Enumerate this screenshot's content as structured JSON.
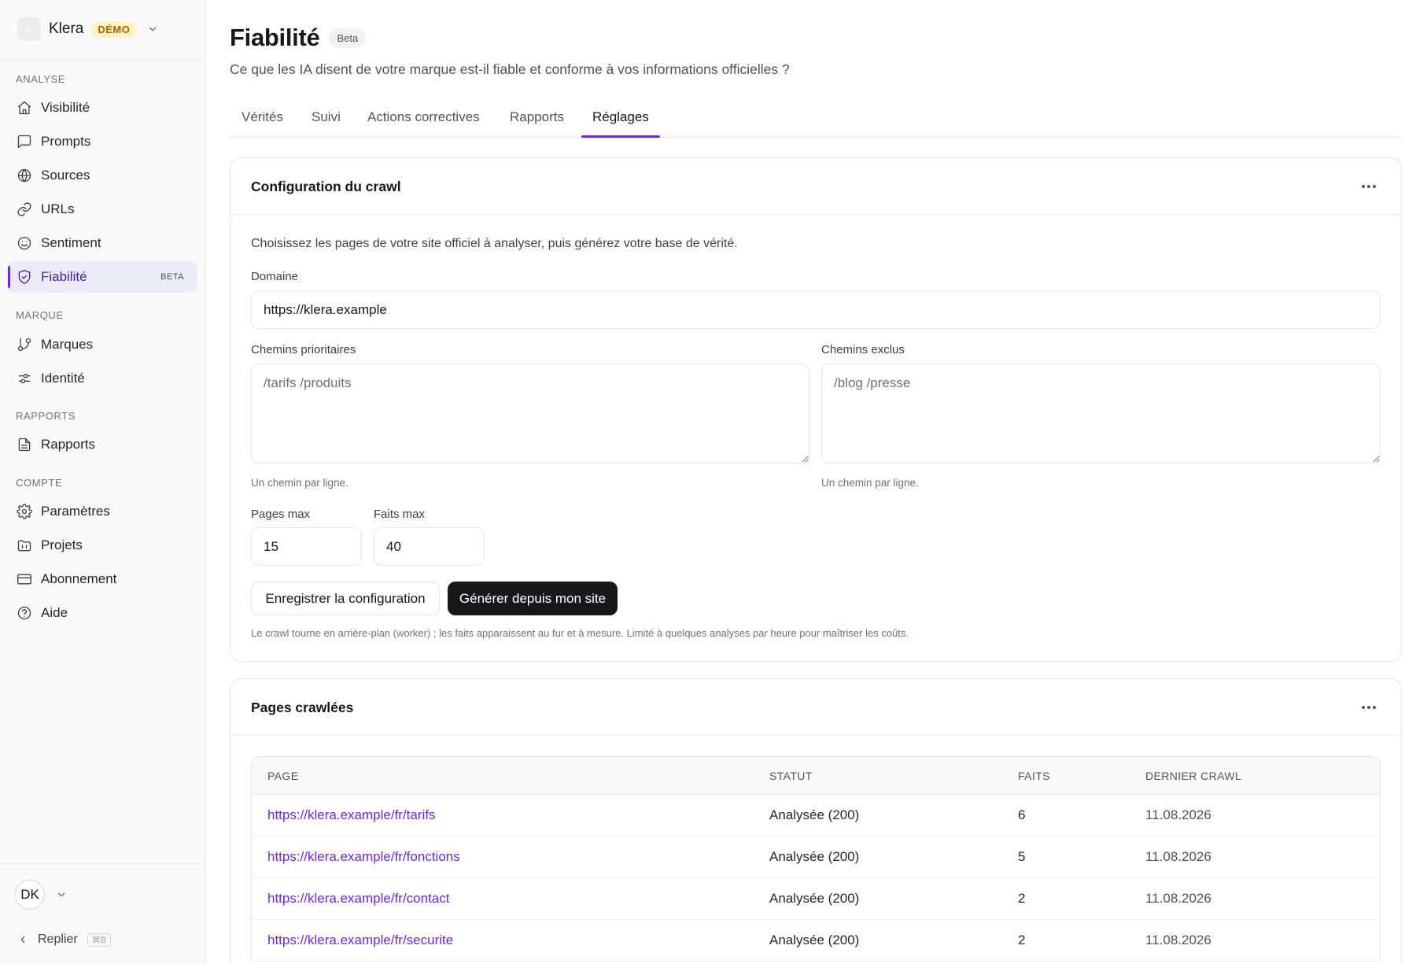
{
  "sidebar": {
    "workspace": {
      "logo": "K",
      "name": "Klera",
      "badge": "DÉMO"
    },
    "sections": [
      {
        "title": "ANALYSE",
        "items": [
          {
            "label": "Visibilité",
            "icon": "home-icon"
          },
          {
            "label": "Prompts",
            "icon": "message-square-icon"
          },
          {
            "label": "Sources",
            "icon": "globe-icon"
          },
          {
            "label": "URLs",
            "icon": "link-icon"
          },
          {
            "label": "Sentiment",
            "icon": "smile-icon"
          },
          {
            "label": "Fiabilité",
            "icon": "shield-check-icon",
            "badge": "BETA",
            "active": true
          }
        ]
      },
      {
        "title": "MARQUE",
        "items": [
          {
            "label": "Marques",
            "icon": "git-branch-icon"
          },
          {
            "label": "Identité",
            "icon": "sliders-icon"
          }
        ]
      },
      {
        "title": "RAPPORTS",
        "items": [
          {
            "label": "Rapports",
            "icon": "file-text-icon"
          }
        ]
      },
      {
        "title": "COMPTE",
        "items": [
          {
            "label": "Paramètres",
            "icon": "settings-icon"
          },
          {
            "label": "Projets",
            "icon": "folder-icon"
          },
          {
            "label": "Abonnement",
            "icon": "credit-card-icon"
          },
          {
            "label": "Aide",
            "icon": "help-circle-icon"
          }
        ]
      }
    ],
    "user": {
      "initials": "DK"
    },
    "collapse": {
      "label": "Replier",
      "shortcut": "⌘B"
    }
  },
  "header": {
    "title": "Fiabilité",
    "badge": "Beta",
    "subtitle": "Ce que les IA disent de votre marque est-il fiable et conforme à vos informations officielles ?"
  },
  "tabs": [
    {
      "label": "Vérités"
    },
    {
      "label": "Suivi"
    },
    {
      "label": "Actions correctives"
    },
    {
      "label": "Rapports"
    },
    {
      "label": "Réglages",
      "active": true
    }
  ],
  "crawl_config": {
    "title": "Configuration du crawl",
    "intro": "Choisissez les pages de votre site officiel à analyser, puis générez votre base de vérité.",
    "domain": {
      "label": "Domaine",
      "value": "https://klera.example"
    },
    "priority_paths": {
      "label": "Chemins prioritaires",
      "placeholder": "/tarifs /produits",
      "hint": "Un chemin par ligne."
    },
    "excluded_paths": {
      "label": "Chemins exclus",
      "placeholder": "/blog /presse",
      "hint": "Un chemin par ligne."
    },
    "pages_max": {
      "label": "Pages max",
      "value": "15"
    },
    "facts_max": {
      "label": "Faits max",
      "value": "40"
    },
    "save_label": "Enregistrer la configuration",
    "generate_label": "Générer depuis mon site",
    "note": "Le crawl tourne en arrière-plan (worker) ; les faits apparaissent au fur et à mesure. Limité à quelques analyses par heure pour maîtriser les coûts."
  },
  "crawled_pages": {
    "title": "Pages crawlées",
    "columns": [
      "PAGE",
      "STATUT",
      "FAITS",
      "DERNIER CRAWL"
    ],
    "rows": [
      {
        "page": "https://klera.example/fr/tarifs",
        "status": "Analysée (200)",
        "facts": "6",
        "date": "11.08.2026"
      },
      {
        "page": "https://klera.example/fr/fonctions",
        "status": "Analysée (200)",
        "facts": "5",
        "date": "11.08.2026"
      },
      {
        "page": "https://klera.example/fr/contact",
        "status": "Analysée (200)",
        "facts": "2",
        "date": "11.08.2026"
      },
      {
        "page": "https://klera.example/fr/securite",
        "status": "Analysée (200)",
        "facts": "2",
        "date": "11.08.2026"
      }
    ]
  },
  "colors": {
    "accent": "#6d28d9",
    "dark_button": "#18181b",
    "badge_demo_bg": "#fdf3c4"
  }
}
